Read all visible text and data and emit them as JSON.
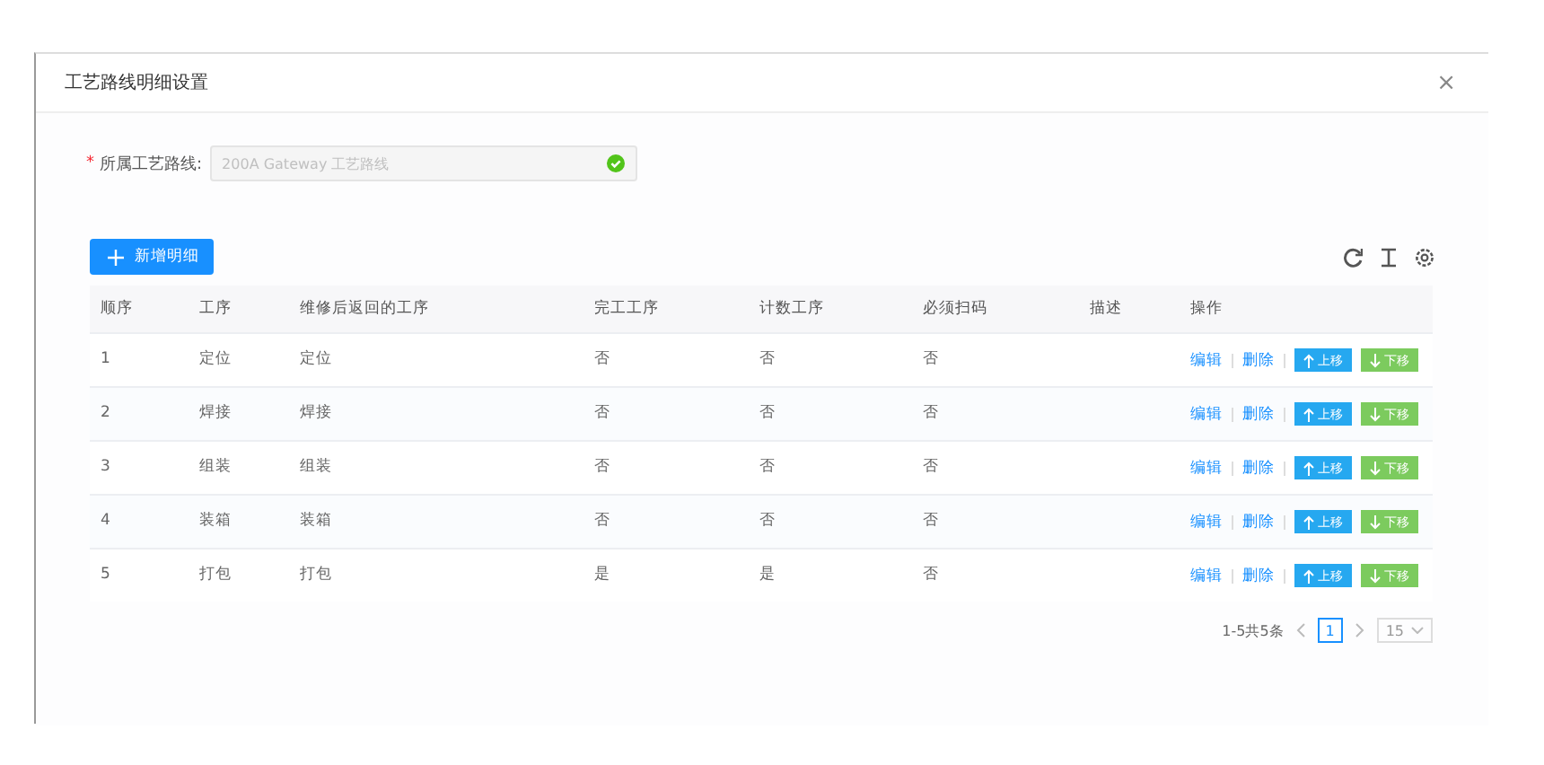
{
  "dialog": {
    "title": "工艺路线明细设置",
    "close": "×"
  },
  "form": {
    "label": "所属工艺路线:",
    "required_mark": "*",
    "value": "200A Gateway 工艺路线",
    "valid": true
  },
  "add_button": "新增明细",
  "table": {
    "columns": [
      "顺序",
      "工序",
      "维修后返回的工序",
      "完工工序",
      "计数工序",
      "必须扫码",
      "描述",
      "操作"
    ],
    "rows": [
      {
        "cells": [
          "1",
          "定位",
          "定位",
          "否",
          "否",
          "否",
          ""
        ],
        "actions": {
          "edit": "编辑",
          "delete": "删除",
          "up": "上移",
          "down": "下移"
        }
      },
      {
        "cells": [
          "2",
          "焊接",
          "焊接",
          "否",
          "否",
          "否",
          ""
        ],
        "actions": {
          "edit": "编辑",
          "delete": "删除",
          "up": "上移",
          "down": "下移"
        }
      },
      {
        "cells": [
          "3",
          "组装",
          "组装",
          "否",
          "否",
          "否",
          ""
        ],
        "actions": {
          "edit": "编辑",
          "delete": "删除",
          "up": "上移",
          "down": "下移"
        }
      },
      {
        "cells": [
          "4",
          "装箱",
          "装箱",
          "否",
          "否",
          "否",
          ""
        ],
        "actions": {
          "edit": "编辑",
          "delete": "删除",
          "up": "上移",
          "down": "下移"
        }
      },
      {
        "cells": [
          "5",
          "打包",
          "打包",
          "是",
          "是",
          "否",
          ""
        ],
        "actions": {
          "edit": "编辑",
          "delete": "删除",
          "up": "上移",
          "down": "下移"
        }
      }
    ]
  },
  "pagination": {
    "summary": "1-5共5条",
    "pages": [
      {
        "label": "1",
        "selected": true
      }
    ],
    "page_size": "15"
  }
}
